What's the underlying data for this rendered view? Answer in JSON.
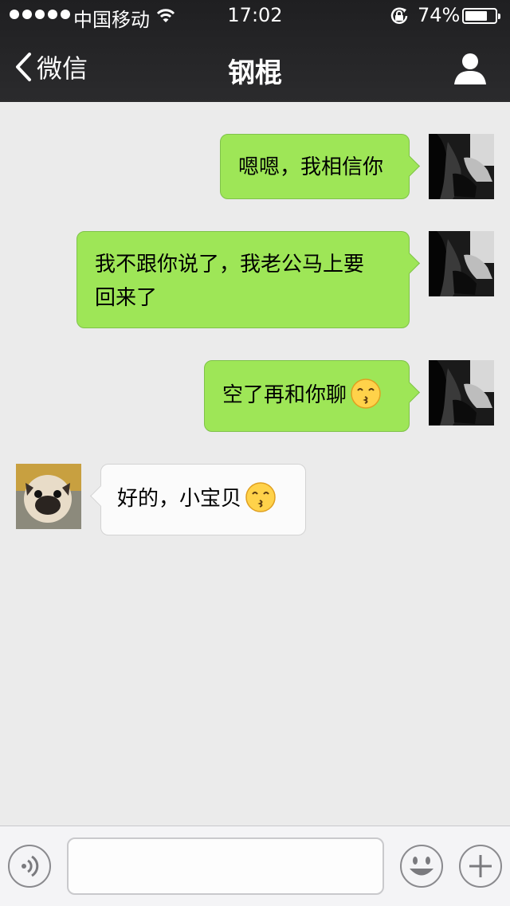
{
  "status_bar": {
    "carrier": "中国移动",
    "time": "17:02",
    "battery_percent_text": "74%",
    "battery_level": 0.74
  },
  "nav": {
    "back_label": "微信",
    "title": "钢棍"
  },
  "messages": [
    {
      "sender": "me",
      "text": "嗯嗯，我相信你"
    },
    {
      "sender": "me",
      "text_line1": "我不跟你说了，我老公马上要",
      "text_line2": "回来了"
    },
    {
      "sender": "me",
      "text": "空了再和你聊",
      "emoji": "kissing-face"
    },
    {
      "sender": "contact",
      "text": "好的，小宝贝",
      "emoji": "kissing-face"
    }
  ],
  "input": {
    "value": "",
    "placeholder": ""
  },
  "icons": {
    "back": "chevron-left-icon",
    "profile": "person-icon",
    "voice": "voice-icon",
    "emoji": "smiley-icon",
    "more": "plus-icon"
  },
  "colors": {
    "my_bubble": "#9ee657",
    "their_bubble": "#fbfbfb",
    "header": "#2b2b2d",
    "chat_background": "#ebebeb"
  }
}
